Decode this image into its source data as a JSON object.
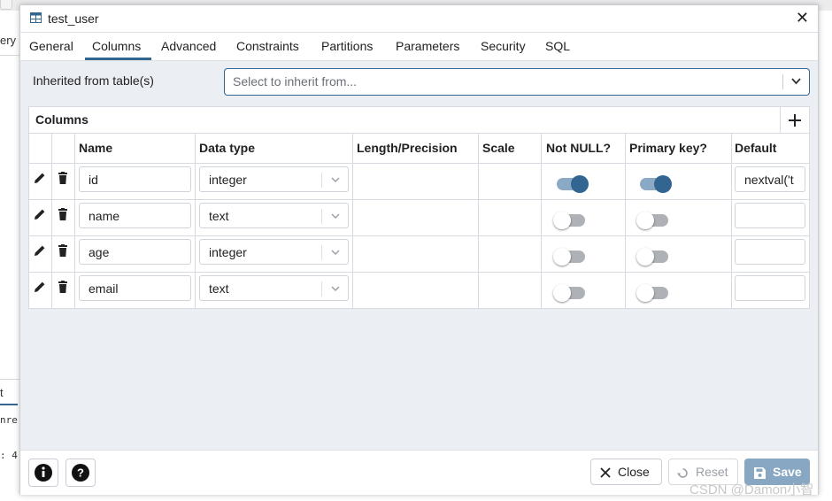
{
  "background": {
    "left_texts": [
      "ery",
      "t",
      "nre",
      ": 4"
    ]
  },
  "dialog": {
    "title": "test_user",
    "tabs": [
      {
        "label": "General"
      },
      {
        "label": "Columns"
      },
      {
        "label": "Advanced"
      },
      {
        "label": "Constraints"
      },
      {
        "label": "Partitions"
      },
      {
        "label": "Parameters"
      },
      {
        "label": "Security"
      },
      {
        "label": "SQL"
      }
    ],
    "active_tab": "Columns",
    "inherit": {
      "label": "Inherited from table(s)",
      "placeholder": "Select to inherit from..."
    },
    "columns_grid": {
      "title": "Columns",
      "headers": [
        "Name",
        "Data type",
        "Length/Precision",
        "Scale",
        "Not NULL?",
        "Primary key?",
        "Default"
      ],
      "rows": [
        {
          "name": "id",
          "data_type": "integer",
          "length": "",
          "scale": "",
          "not_null": true,
          "primary_key": true,
          "default": "nextval('t"
        },
        {
          "name": "name",
          "data_type": "text",
          "length": "",
          "scale": "",
          "not_null": false,
          "primary_key": false,
          "default": ""
        },
        {
          "name": "age",
          "data_type": "integer",
          "length": "",
          "scale": "",
          "not_null": false,
          "primary_key": false,
          "default": ""
        },
        {
          "name": "email",
          "data_type": "text",
          "length": "",
          "scale": "",
          "not_null": false,
          "primary_key": false,
          "default": ""
        }
      ]
    },
    "footer": {
      "close_label": "Close",
      "reset_label": "Reset",
      "save_label": "Save"
    }
  },
  "watermark": "CSDN @Damon小智",
  "colors": {
    "accent": "#326690",
    "toggle_on_track": "#8aa9c4",
    "save_button": "#88a7c3",
    "dialog_body": "#ebeef3"
  },
  "icons": [
    "table-icon",
    "close-icon",
    "chevron-down-icon",
    "plus-icon",
    "edit-icon",
    "trash-icon",
    "info-icon",
    "help-icon",
    "reset-icon",
    "save-icon"
  ]
}
